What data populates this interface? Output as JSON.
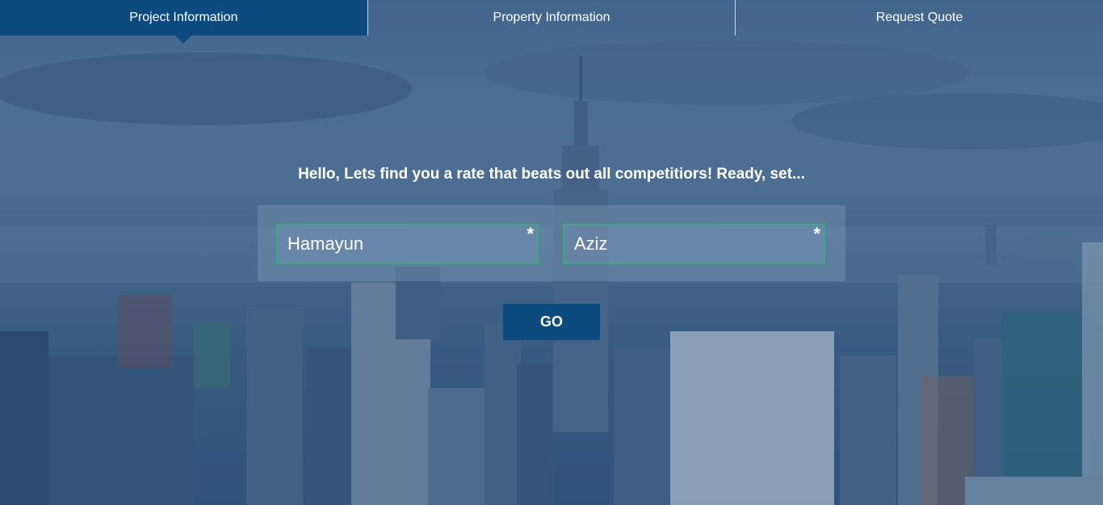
{
  "tabs": [
    {
      "label": "Project Information",
      "active": true
    },
    {
      "label": "Property Information",
      "active": false
    },
    {
      "label": "Request Quote",
      "active": false
    }
  ],
  "hero": {
    "greeting": "Hello, Lets find you a rate that beats out all competitiors! Ready, set..."
  },
  "form": {
    "first_name": {
      "value": "Hamayun",
      "required_mark": "*"
    },
    "last_name": {
      "value": "Aziz",
      "required_mark": "*"
    },
    "submit_label": "GO"
  },
  "colors": {
    "primary": "#0d4a80",
    "field_border": "#3aa97c",
    "text": "#ffffff"
  }
}
